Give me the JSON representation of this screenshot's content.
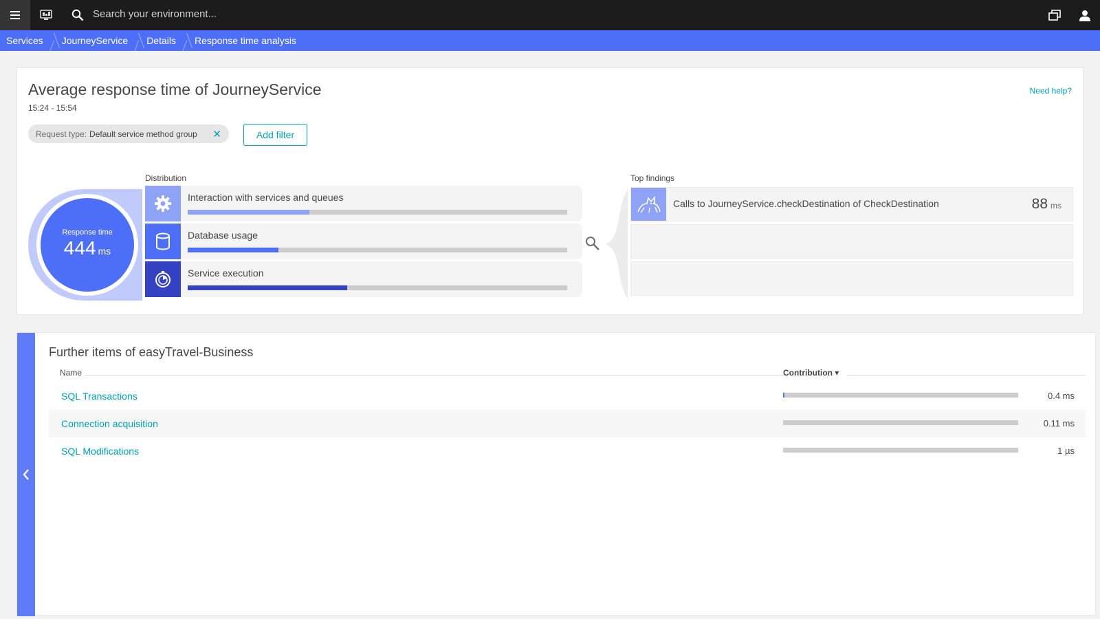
{
  "topbar": {
    "search_placeholder": "Search your environment..."
  },
  "breadcrumb": [
    "Services",
    "JourneyService",
    "Details",
    "Response time analysis"
  ],
  "analysis": {
    "title": "Average response time of JourneyService",
    "timeframe": "15:24 - 15:54",
    "help_link": "Need help?",
    "filter": {
      "key": "Request type:",
      "value": "Default service method group"
    },
    "add_filter_label": "Add filter",
    "distribution_label": "Distribution",
    "response_time": {
      "label": "Response time",
      "value": "444",
      "unit": "ms"
    },
    "distribution": [
      {
        "name": "Interaction with services and queues",
        "icon": "gear-icon",
        "color": "#8ea2f6",
        "fraction": 0.32
      },
      {
        "name": "Database usage",
        "icon": "database-icon",
        "color": "#4d6ff7",
        "fraction": 0.24
      },
      {
        "name": "Service execution",
        "icon": "stopwatch-icon",
        "color": "#3441c2",
        "fraction": 0.42
      }
    ],
    "top_findings_label": "Top findings",
    "findings": [
      {
        "text": "Calls to JourneyService.checkDestination of CheckDestination",
        "value": "88",
        "unit": "ms",
        "icon": "tomcat-icon"
      }
    ]
  },
  "further_items": {
    "title": "Further items of easyTravel-Business",
    "col_name": "Name",
    "col_contribution": "Contribution ▾",
    "rows": [
      {
        "name": "SQL Transactions",
        "value": "0.4 ms",
        "fraction": 0.005
      },
      {
        "name": "Connection acquisition",
        "value": "0.11 ms",
        "fraction": 0.0
      },
      {
        "name": "SQL Modifications",
        "value": "1 µs",
        "fraction": 0.0
      }
    ]
  },
  "colors": {
    "accent": "#4d6ff7",
    "link": "#00a1b2",
    "topbar": "#1c1c1c"
  }
}
